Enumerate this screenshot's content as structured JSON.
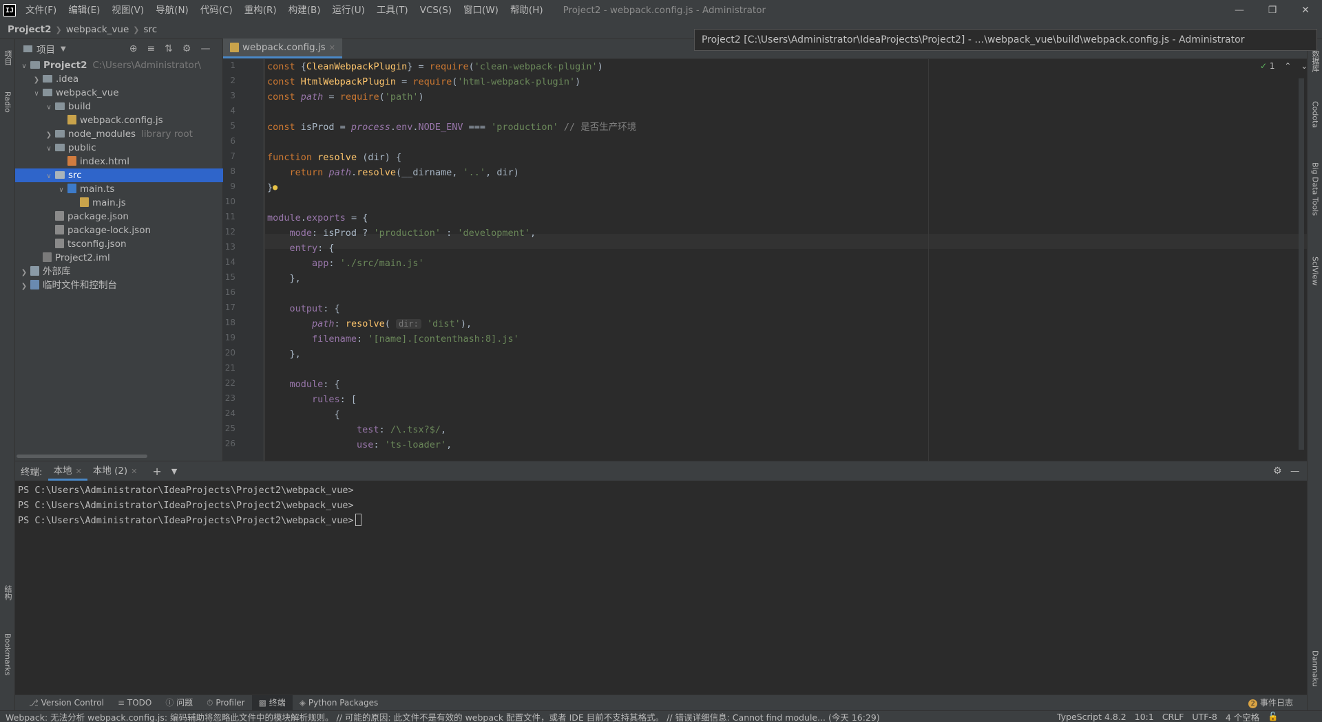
{
  "app": {
    "logo": "IJ",
    "window_title": "Project2 - webpack.config.js - Administrator",
    "menu": [
      "文件(F)",
      "编辑(E)",
      "视图(V)",
      "导航(N)",
      "代码(C)",
      "重构(R)",
      "构建(B)",
      "运行(U)",
      "工具(T)",
      "VCS(S)",
      "窗口(W)",
      "帮助(H)"
    ]
  },
  "breadcrumb": [
    "Project2",
    "webpack_vue",
    "src"
  ],
  "tooltip": "Project2 [C:\\Users\\Administrator\\IdeaProjects\\Project2] - …\\webpack_vue\\build\\webpack.config.js - Administrator",
  "left_stripe": {
    "project_tab": "项目",
    "radio_tab": "Radio",
    "structure_tab": "结构",
    "bookmarks_tab": "Bookmarks"
  },
  "right_stripe": {
    "db_tab": "数据库",
    "codota_tab": "Codota",
    "bigdata_tab": "Big Data Tools",
    "sciview_tab": "SciView",
    "danmaku_tab": "Danmaku"
  },
  "project_panel": {
    "title": "项目",
    "tree": [
      {
        "label": "Project2",
        "hint": "C:\\Users\\Administrator\\",
        "indent": 0,
        "arrow": "down",
        "icon": "folder",
        "bold": true
      },
      {
        "label": ".idea",
        "hint": "",
        "indent": 1,
        "arrow": "right",
        "icon": "folder"
      },
      {
        "label": "webpack_vue",
        "hint": "",
        "indent": 1,
        "arrow": "down",
        "icon": "folder"
      },
      {
        "label": "build",
        "hint": "",
        "indent": 2,
        "arrow": "down",
        "icon": "folder"
      },
      {
        "label": "webpack.config.js",
        "hint": "",
        "indent": 3,
        "arrow": "",
        "icon": "js"
      },
      {
        "label": "node_modules",
        "hint": "library root",
        "indent": 2,
        "arrow": "right",
        "icon": "folder"
      },
      {
        "label": "public",
        "hint": "",
        "indent": 2,
        "arrow": "down",
        "icon": "folder"
      },
      {
        "label": "index.html",
        "hint": "",
        "indent": 3,
        "arrow": "",
        "icon": "html"
      },
      {
        "label": "src",
        "hint": "",
        "indent": 2,
        "arrow": "down",
        "icon": "folder",
        "selected": true
      },
      {
        "label": "main.ts",
        "hint": "",
        "indent": 3,
        "arrow": "down",
        "icon": "ts"
      },
      {
        "label": "main.js",
        "hint": "",
        "indent": 4,
        "arrow": "",
        "icon": "js"
      },
      {
        "label": "package.json",
        "hint": "",
        "indent": 2,
        "arrow": "",
        "icon": "json"
      },
      {
        "label": "package-lock.json",
        "hint": "",
        "indent": 2,
        "arrow": "",
        "icon": "json"
      },
      {
        "label": "tsconfig.json",
        "hint": "",
        "indent": 2,
        "arrow": "",
        "icon": "json"
      },
      {
        "label": "Project2.iml",
        "hint": "",
        "indent": 1,
        "arrow": "",
        "icon": "iml"
      },
      {
        "label": "外部库",
        "hint": "",
        "indent": 0,
        "arrow": "right",
        "icon": "lib"
      },
      {
        "label": "临时文件和控制台",
        "hint": "",
        "indent": 0,
        "arrow": "right",
        "icon": "scratch"
      }
    ]
  },
  "editor": {
    "tab_label": "webpack.config.js",
    "inspection_count": "1",
    "lines": [
      "const {CleanWebpackPlugin} = require('clean-webpack-plugin')",
      "const HtmlWebpackPlugin = require('html-webpack-plugin')",
      "const path = require('path')",
      "",
      "const isProd = process.env.NODE_ENV === 'production' // 是否生产环境",
      "",
      "function resolve (dir) {",
      "    return path.resolve(__dirname, '..', dir)",
      "}",
      "",
      "module.exports = {",
      "    mode: isProd ? 'production' : 'development',",
      "    entry: {",
      "        app: './src/main.js'",
      "    },",
      "",
      "    output: {",
      "        path: resolve( dir: 'dist'),",
      "        filename: '[name].[contenthash:8].js'",
      "    },",
      "",
      "    module: {",
      "        rules: [",
      "            {",
      "                test: /\\.tsx?$/,",
      "                use: 'ts-loader',"
    ]
  },
  "terminal": {
    "label": "终端:",
    "tabs": [
      "本地",
      "本地 (2)"
    ],
    "lines": [
      "PS C:\\Users\\Administrator\\IdeaProjects\\Project2\\webpack_vue>",
      "PS C:\\Users\\Administrator\\IdeaProjects\\Project2\\webpack_vue>",
      "PS C:\\Users\\Administrator\\IdeaProjects\\Project2\\webpack_vue>"
    ]
  },
  "bottom_toolbar": {
    "items": [
      "Version Control",
      "TODO",
      "问题",
      "Profiler",
      "终端",
      "Python Packages"
    ],
    "event_log": "事件日志",
    "event_count": "2"
  },
  "status_bar": {
    "message": "Webpack: 无法分析 webpack.config.js: 编码辅助将忽略此文件中的模块解析规则。 // 可能的原因: 此文件不是有效的 webpack 配置文件，或者 IDE 目前不支持其格式。 // 错误详细信息:  Cannot find module... (今天 16:29)",
    "typescript": "TypeScript 4.8.2",
    "position": "10:1",
    "line_sep": "CRLF",
    "encoding": "UTF-8",
    "indent": "4 个空格"
  }
}
